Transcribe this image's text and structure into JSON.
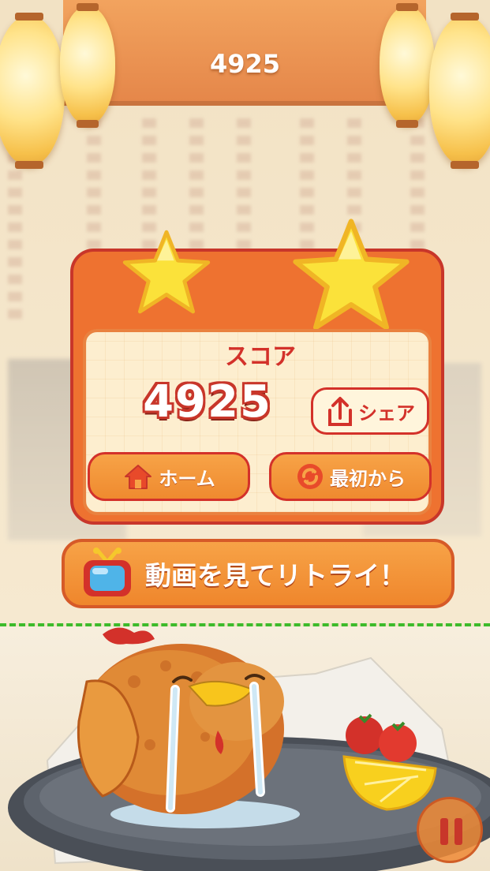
{
  "header": {
    "score": "4925"
  },
  "result": {
    "score_label": "スコア",
    "score_value": "4925",
    "share_label": "シェア",
    "home_label": "ホーム",
    "restart_label": "最初から"
  },
  "retry": {
    "label": "動画を見てリトライ！"
  },
  "colors": {
    "panel_orange": "#ee7230",
    "panel_border": "#c8362a",
    "button_orange": "#f39a3e",
    "accent_red": "#d3312a",
    "limit_line_green": "#3dbb2b"
  },
  "icons": [
    "lantern",
    "star",
    "share-icon",
    "home-icon",
    "restart-icon",
    "tv-icon",
    "pause-icon"
  ]
}
